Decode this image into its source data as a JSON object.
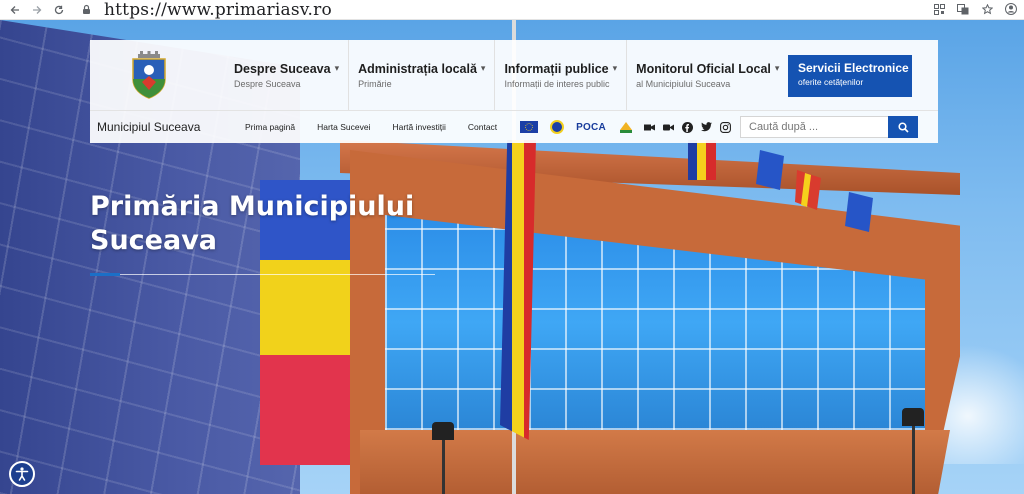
{
  "browser": {
    "url": "https://www.primariasv.ro",
    "icons": [
      "back-arrow-icon",
      "forward-arrow-icon",
      "reload-icon",
      "lock-icon",
      "qr-icon",
      "translate-icon",
      "star-icon",
      "profile-icon"
    ]
  },
  "header": {
    "nav": [
      {
        "title": "Despre Suceava",
        "sub": "Despre Suceava"
      },
      {
        "title": "Administrația locală",
        "sub": "Primărie"
      },
      {
        "title": "Informații publice",
        "sub": "Informații de interes public"
      },
      {
        "title": "Monitorul Oficial Local",
        "sub": "al Municipiului Suceava"
      }
    ],
    "services": {
      "title": "Servicii Electronice",
      "sub": "oferite cetățenilor"
    },
    "city_name": "Municipiul Suceava",
    "links": [
      "Prima pagină",
      "Harta Sucevei",
      "Hartă investiții",
      "Contact"
    ],
    "partner_poca": "POCA",
    "search_placeholder": "Caută după ...",
    "social_icons": [
      "camera-icon",
      "video-icon",
      "facebook-icon",
      "twitter-icon",
      "instagram-icon"
    ]
  },
  "hero": {
    "title_line1": "Primăria Municipiului",
    "title_line2": "Suceava"
  },
  "colors": {
    "accent": "#1553b2",
    "hero_title": "#ffffff",
    "a11y": "#1d3f8f"
  }
}
